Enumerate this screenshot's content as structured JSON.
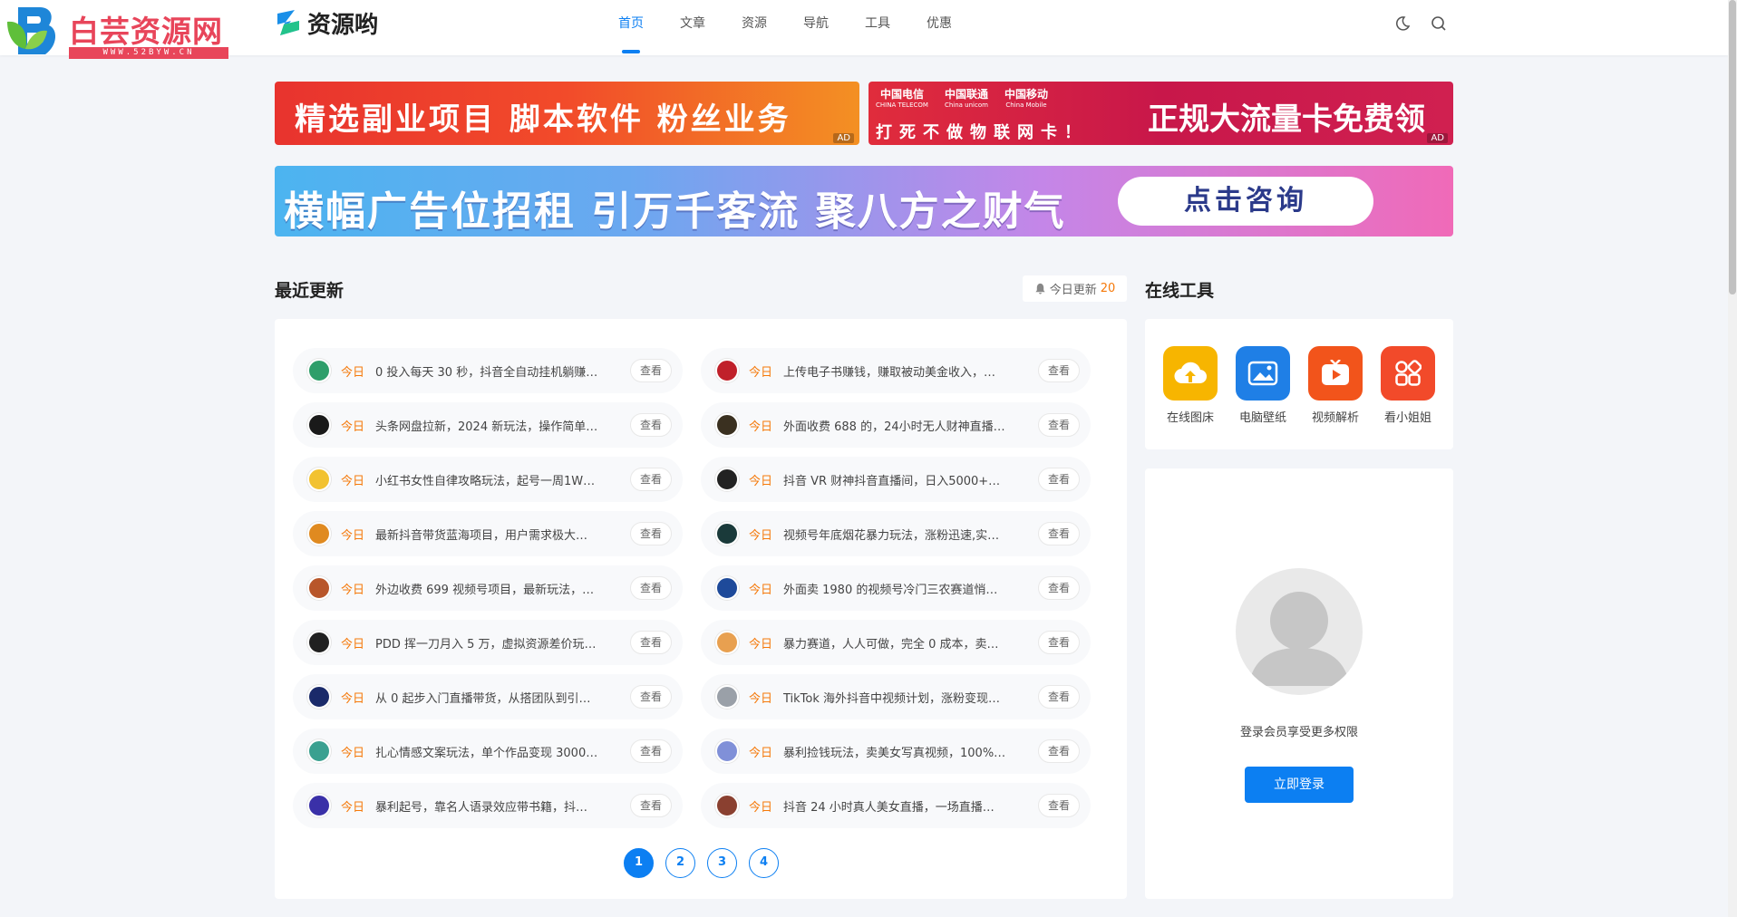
{
  "watermark": {
    "title": "白芸资源网",
    "url": "WWW.52BYW.CN"
  },
  "logo": {
    "text": "资源哟"
  },
  "nav": {
    "items": [
      "首页",
      "文章",
      "资源",
      "导航",
      "工具",
      "优惠"
    ],
    "active_index": 0
  },
  "header_icons": [
    "moon-icon",
    "search-icon"
  ],
  "banners": {
    "ad_label": "AD",
    "banner1": "精选副业项目 脚本软件 粉丝业务",
    "banner2": {
      "carriers": [
        {
          "cn": "中国电信",
          "en": "CHINA TELECOM"
        },
        {
          "cn": "中国联通",
          "en": "China unicom"
        },
        {
          "cn": "中国移动",
          "en": "China Mobile"
        }
      ],
      "slogan": "打死不做物联网卡！",
      "main": "正规大流量卡免费领"
    },
    "banner3": {
      "main": "横幅广告位招租 引万千客流 聚八方之财气",
      "button": "点击咨询"
    }
  },
  "recent": {
    "title": "最近更新",
    "today_label": "今日更新",
    "today_count": "20",
    "tag": "今日",
    "view_label": "查看",
    "items": [
      {
        "title": "0 投入每天 30 秒，抖音全自动挂机躺赚…",
        "color": "#2e9e6a"
      },
      {
        "title": "上传电子书赚钱，赚取被动美金收入，…",
        "color": "#c0202a"
      },
      {
        "title": "头条网盘拉新，2024 新玩法，操作简单…",
        "color": "#1a1a1a"
      },
      {
        "title": "外面收费 688 的，24小时无人财神直播…",
        "color": "#3a3020"
      },
      {
        "title": "小红书女性自律攻略玩法，起号一周1W…",
        "color": "#f2c230"
      },
      {
        "title": "抖音 VR 财神抖音直播间，日入5000+…",
        "color": "#222222"
      },
      {
        "title": "最新抖音带货蓝海项目，用户需求极大…",
        "color": "#e08a20"
      },
      {
        "title": "视频号年底烟花暴力玩法，涨粉迅速,实…",
        "color": "#1a3a3a"
      },
      {
        "title": "外边收费 699 视频号项目，最新玩法，…",
        "color": "#b8562a"
      },
      {
        "title": "外面卖 1980 的视频号冷门三农赛道悄…",
        "color": "#1e4a9a"
      },
      {
        "title": "PDD 挥一刀月入 5 万，虚拟资源差价玩…",
        "color": "#202020"
      },
      {
        "title": "暴力赛道，人人可做，完全 0 成本，卖…",
        "color": "#e8a050"
      },
      {
        "title": "从 0 起步入门直播带货，从搭团队到引…",
        "color": "#1a2a6a"
      },
      {
        "title": "TikTok 海外抖音中视频计划，涨粉变现…",
        "color": "#9aa0a8"
      },
      {
        "title": "扎心情感文案玩法，单个作品变现 3000…",
        "color": "#3aa090"
      },
      {
        "title": "暴利捡钱玩法，卖美女写真视频，100%…",
        "color": "#8090d8"
      },
      {
        "title": "暴利起号，靠名人语录效应带书籍，抖…",
        "color": "#3a30a8"
      },
      {
        "title": "抖音 24 小时真人美女直播，一场直播…",
        "color": "#8a4030"
      }
    ],
    "pages": [
      "1",
      "2",
      "3",
      "4"
    ],
    "current_page": "1"
  },
  "tools": {
    "title": "在线工具",
    "items": [
      {
        "label": "在线图床",
        "icon": "cloud-upload-icon",
        "color": "#f7b500"
      },
      {
        "label": "电脑壁纸",
        "icon": "image-icon",
        "color": "#1f7fe6"
      },
      {
        "label": "视频解析",
        "icon": "video-icon",
        "color": "#f2541b"
      },
      {
        "label": "看小姐姐",
        "icon": "apps-icon",
        "color": "#f24a2a"
      }
    ]
  },
  "login": {
    "tip": "登录会员享受更多权限",
    "button": "立即登录"
  }
}
